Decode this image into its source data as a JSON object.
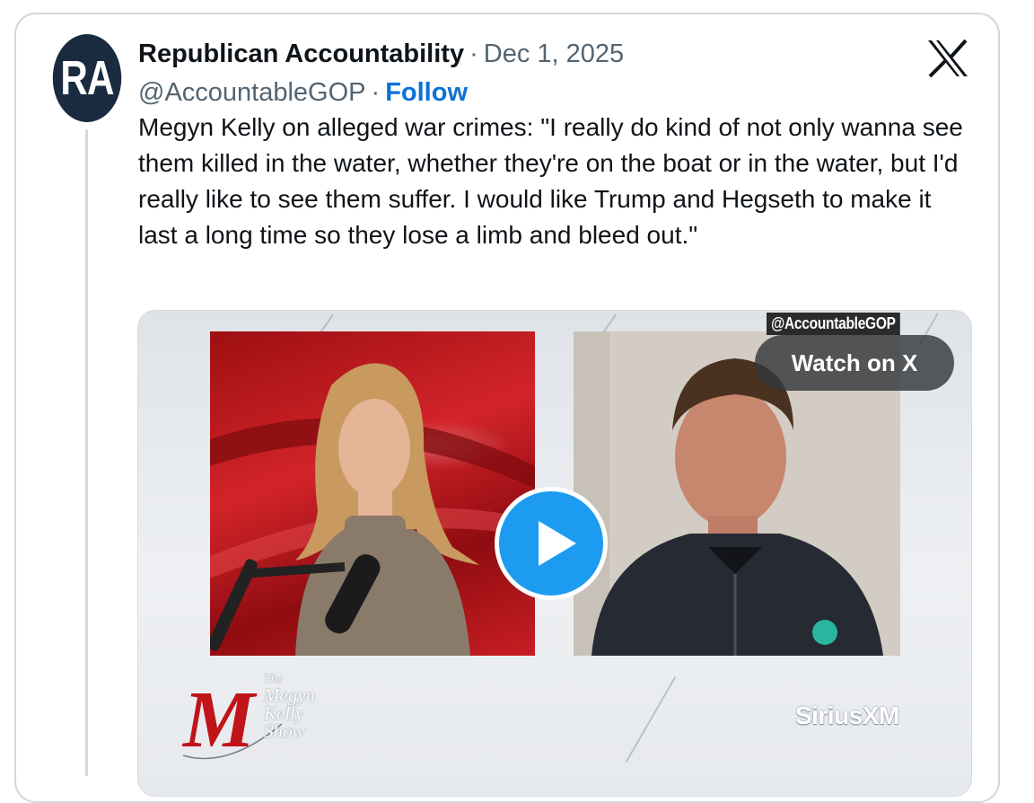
{
  "tweet": {
    "avatar_initials": "RA",
    "display_name": "Republican Accountability",
    "separator": "·",
    "date": "Dec 1, 2025",
    "handle": "@AccountableGOP",
    "follow_label": "Follow",
    "text": "Megyn Kelly on alleged war crimes: \"I really do kind of not only wanna see them killed in the water, whether they're on the boat or in the water, but I'd really like to see them suffer. I would like Trump and Hegseth to make it last a long time so they lose a limb and bleed out.\""
  },
  "media": {
    "watermark": "@AccountableGOP",
    "watch_label": "Watch on X",
    "show_title_lines": [
      "The",
      "Megyn",
      "Kelly",
      "Show"
    ],
    "show_logo_letter": "M",
    "network": "SiriusXM"
  },
  "icons": {
    "brand": "x-logo-icon",
    "play": "play-icon"
  },
  "colors": {
    "follow": "#0a72d6",
    "play_button": "#1d9bf0",
    "avatar_bg": "#1a2b3f",
    "show_logo": "#c0141a"
  }
}
